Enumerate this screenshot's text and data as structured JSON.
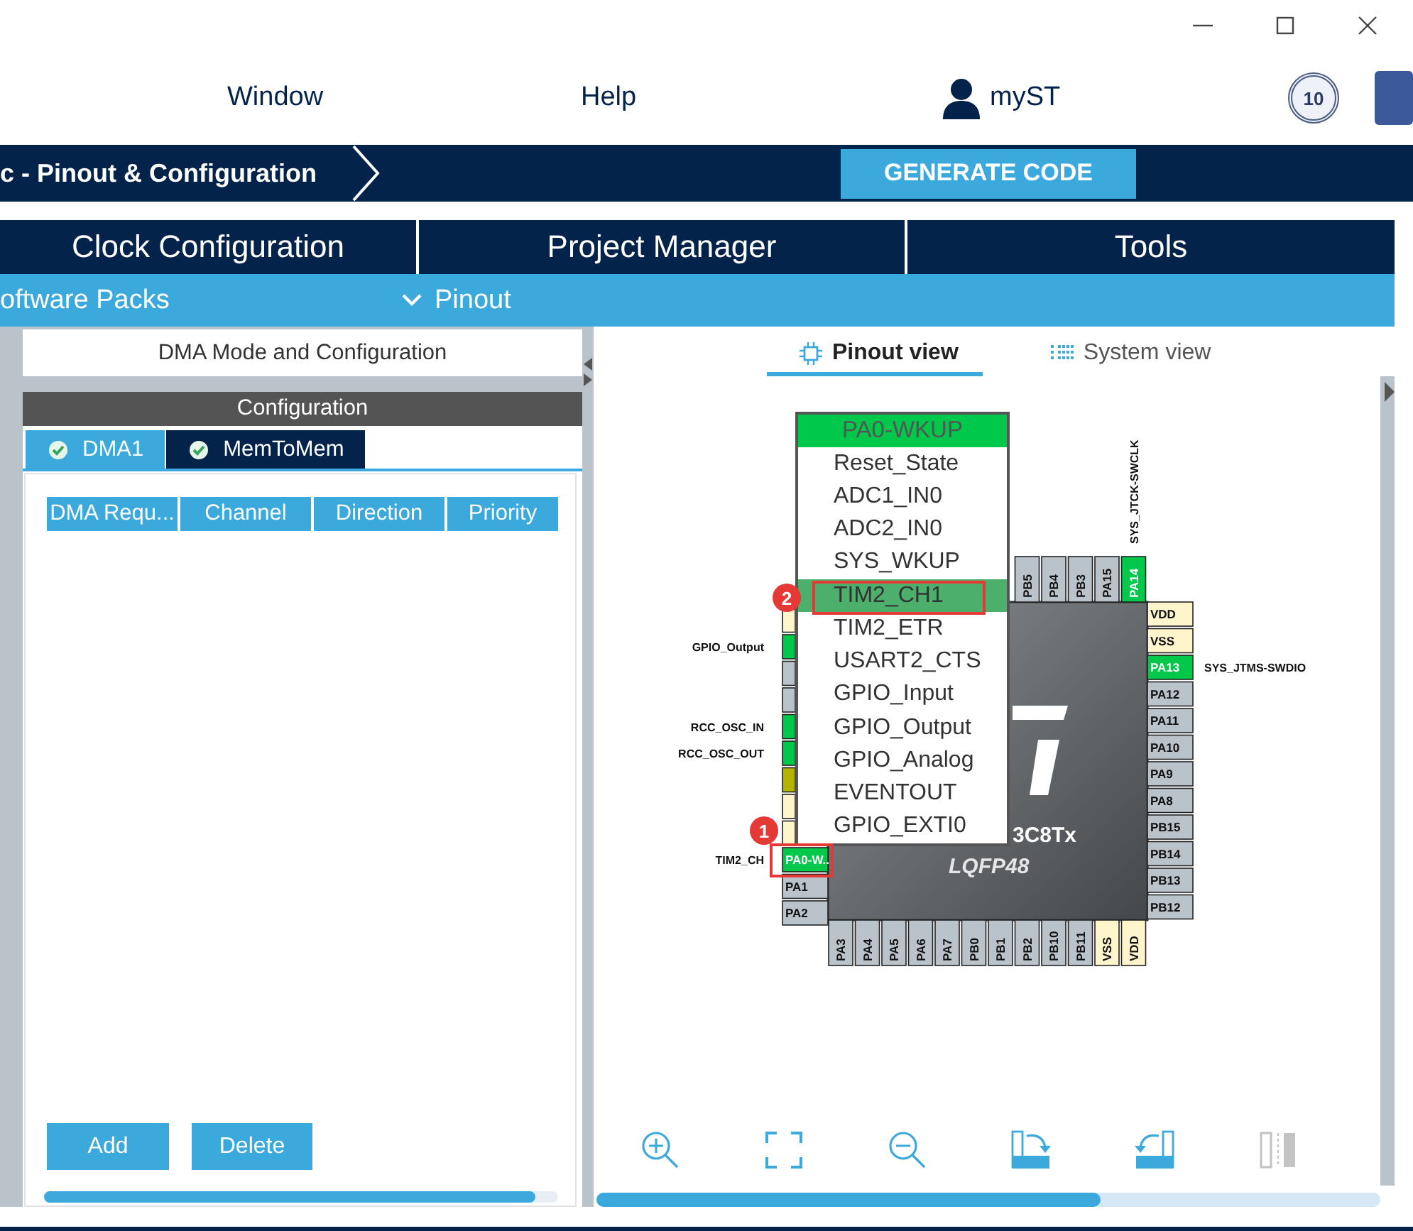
{
  "menu": [
    {
      "label": "Window"
    },
    {
      "label": "Help"
    }
  ],
  "account": {
    "label": "myST"
  },
  "emblem": {
    "label": "10"
  },
  "breadcrumb": {
    "label": "c - Pinout & Configuration"
  },
  "generate_button": {
    "label": "GENERATE CODE"
  },
  "tabs": [
    {
      "label": "Clock Configuration"
    },
    {
      "label": "Project Manager"
    },
    {
      "label": "Tools"
    }
  ],
  "sub_menu": [
    {
      "label": "oftware Packs",
      "kind": "link"
    },
    {
      "label": "Pinout",
      "kind": "dropdown"
    }
  ],
  "dma_panel": {
    "title": "DMA Mode and Configuration",
    "section": "Configuration",
    "tabs": [
      {
        "label": "DMA1",
        "selected": true
      },
      {
        "label": "MemToMem",
        "selected": false
      }
    ],
    "columns": [
      "DMA Requ...",
      "Channel",
      "Direction",
      "Priority"
    ],
    "buttons": [
      "Add",
      "Delete"
    ]
  },
  "pinout": {
    "views": [
      {
        "label": "Pinout view",
        "selected": true
      },
      {
        "label": "System view",
        "selected": false
      }
    ],
    "chip": {
      "name": "3C8Tx",
      "package": "LQFP48",
      "top": [
        {
          "label": "PB5",
          "kind": "free"
        },
        {
          "label": "PB4",
          "kind": "free"
        },
        {
          "label": "PB3",
          "kind": "free"
        },
        {
          "label": "PA15",
          "kind": "free"
        },
        {
          "label": "PA14",
          "kind": "assigned",
          "signal": "SYS_JTCK-SWCLK"
        }
      ],
      "left": [
        {
          "kind": "power"
        },
        {
          "kind": "assigned",
          "signal": "GPIO_Output"
        },
        {
          "kind": "free"
        },
        {
          "kind": "free"
        },
        {
          "kind": "assigned",
          "signal": "RCC_OSC_IN"
        },
        {
          "kind": "assigned",
          "signal": "RCC_OSC_OUT"
        },
        {
          "kind": "reset"
        },
        {
          "kind": "power"
        },
        {
          "kind": "power"
        },
        {
          "label": "PA0-W..",
          "kind": "assigned",
          "signal": "TIM2_CH"
        },
        {
          "label": "PA1",
          "kind": "free"
        },
        {
          "label": "PA2",
          "kind": "free"
        }
      ],
      "right": [
        {
          "label": "VDD",
          "kind": "power"
        },
        {
          "label": "VSS",
          "kind": "power"
        },
        {
          "label": "PA13",
          "kind": "assigned",
          "signal": "SYS_JTMS-SWDIO"
        },
        {
          "label": "PA12",
          "kind": "free"
        },
        {
          "label": "PA11",
          "kind": "free"
        },
        {
          "label": "PA10",
          "kind": "free"
        },
        {
          "label": "PA9",
          "kind": "free"
        },
        {
          "label": "PA8",
          "kind": "free"
        },
        {
          "label": "PB15",
          "kind": "free"
        },
        {
          "label": "PB14",
          "kind": "free"
        },
        {
          "label": "PB13",
          "kind": "free"
        },
        {
          "label": "PB12",
          "kind": "free"
        }
      ],
      "bottom": [
        {
          "label": "PA3",
          "kind": "free"
        },
        {
          "label": "PA4",
          "kind": "free"
        },
        {
          "label": "PA5",
          "kind": "free"
        },
        {
          "label": "PA6",
          "kind": "free"
        },
        {
          "label": "PA7",
          "kind": "free"
        },
        {
          "label": "PB0",
          "kind": "free"
        },
        {
          "label": "PB1",
          "kind": "free"
        },
        {
          "label": "PB2",
          "kind": "free"
        },
        {
          "label": "PB10",
          "kind": "free"
        },
        {
          "label": "PB11",
          "kind": "free"
        },
        {
          "label": "VSS",
          "kind": "power"
        },
        {
          "label": "VDD",
          "kind": "power"
        }
      ]
    },
    "popup": {
      "pin": "PA0-WKUP",
      "items": [
        {
          "label": "Reset_State",
          "selected": false
        },
        {
          "label": "ADC1_IN0",
          "selected": false
        },
        {
          "label": "ADC2_IN0",
          "selected": false
        },
        {
          "label": "SYS_WKUP",
          "selected": false
        },
        {
          "label": "TIM2_CH1",
          "selected": true
        },
        {
          "label": "TIM2_ETR",
          "selected": false
        },
        {
          "label": "USART2_CTS",
          "selected": false
        },
        {
          "label": "GPIO_Input",
          "selected": false
        },
        {
          "label": "GPIO_Output",
          "selected": false
        },
        {
          "label": "GPIO_Analog",
          "selected": false
        },
        {
          "label": "EVENTOUT",
          "selected": false
        },
        {
          "label": "GPIO_EXTI0",
          "selected": false
        }
      ]
    },
    "annotations": [
      {
        "number": "1",
        "kind": "pin"
      },
      {
        "number": "2",
        "kind": "menu_item"
      }
    ],
    "toolbar": [
      {
        "kind": "zoom_in",
        "disabled": false
      },
      {
        "kind": "fit",
        "disabled": false
      },
      {
        "kind": "zoom_out",
        "disabled": false
      },
      {
        "kind": "rotate_right",
        "disabled": false
      },
      {
        "kind": "rotate_left",
        "disabled": false
      },
      {
        "kind": "split",
        "disabled": true
      }
    ]
  }
}
